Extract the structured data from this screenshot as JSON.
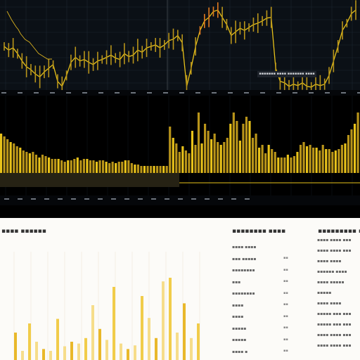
{
  "chart_data": [
    {
      "type": "line",
      "title": "",
      "x": [
        0,
        1,
        2,
        3,
        4,
        5,
        6,
        7,
        8,
        9,
        10,
        11,
        12,
        13,
        14,
        15,
        16,
        17,
        18,
        19,
        20,
        21,
        22,
        23,
        24,
        25,
        26,
        27,
        28,
        29,
        30,
        31,
        32,
        33,
        34,
        35,
        36,
        37,
        38,
        39,
        40,
        41,
        42,
        43,
        44,
        45,
        46,
        47,
        48,
        49,
        50,
        51,
        52,
        53,
        54,
        55,
        56,
        57,
        58,
        59,
        60,
        61,
        62,
        63,
        64,
        65,
        66,
        67,
        68,
        69,
        70,
        71,
        72,
        73,
        74,
        75,
        76,
        77,
        78,
        79
      ],
      "series": [
        {
          "values": [
            60,
            55,
            58,
            50,
            40,
            32,
            28,
            22,
            18,
            25,
            30,
            35,
            12,
            5,
            20,
            38,
            45,
            40,
            42,
            38,
            35,
            40,
            42,
            45,
            48,
            44,
            42,
            50,
            46,
            48,
            55,
            52,
            58,
            60,
            62,
            58,
            62,
            68,
            70,
            75,
            65,
            5,
            30,
            60,
            82,
            95,
            100,
            108,
            110,
            100,
            90,
            75,
            80,
            85,
            82,
            86,
            90,
            92,
            95,
            99,
            100,
            30,
            12,
            10,
            5,
            8,
            6,
            10,
            5,
            4,
            8,
            6,
            8,
            20,
            40,
            60,
            82,
            92,
            105,
            110
          ]
        },
        {
          "values": [
            112,
            106,
            100,
            95,
            90,
            86,
            80,
            76,
            72,
            70,
            68,
            64,
            60,
            56,
            52,
            50,
            48,
            46,
            44,
            44,
            44
          ]
        }
      ],
      "grid": true
    },
    {
      "type": "bar",
      "title": "",
      "values": [
        56,
        52,
        48,
        44,
        42,
        38,
        36,
        32,
        30,
        28,
        30,
        26,
        22,
        26,
        24,
        22,
        20,
        20,
        20,
        18,
        16,
        18,
        18,
        20,
        22,
        18,
        20,
        20,
        18,
        18,
        16,
        18,
        18,
        16,
        14,
        16,
        14,
        16,
        16,
        18,
        18,
        14,
        12,
        12,
        10,
        10,
        10,
        10,
        10,
        10,
        10,
        10,
        10,
        66,
        50,
        42,
        30,
        38,
        32,
        28,
        60,
        40,
        86,
        42,
        70,
        60,
        48,
        56,
        44,
        40,
        44,
        50,
        70,
        86,
        74,
        46,
        70,
        80,
        74,
        50,
        56,
        36,
        40,
        28,
        40,
        34,
        30,
        22,
        22,
        22,
        26,
        22,
        24,
        30,
        40,
        44,
        38,
        40,
        36,
        36,
        32,
        40,
        34,
        34,
        30,
        32,
        34,
        40,
        42,
        54,
        62,
        70,
        86
      ],
      "grid": true
    },
    {
      "type": "bar",
      "title": "",
      "values": [
        30,
        10,
        40,
        20,
        12,
        10,
        45,
        15,
        20,
        18,
        24,
        60,
        34,
        22,
        80,
        18,
        12,
        16,
        70,
        46,
        24,
        86,
        90,
        30,
        62,
        24,
        40
      ],
      "grid": true
    }
  ],
  "price_badge": "▪▪▪▪▪▪▪ ▪▪▪▪ ▪▪▪▪▪▪▪ ▪▪▪▪",
  "report": {
    "left_heading": "▪▪▪▪ ▪▪▪▪▪▪",
    "mid_heading": "▪▪▪▪▪▪▪▪ ▪▪▪▪",
    "right_heading": "▪▪▪▪▪▪▪▪▪ ▪▪▪▪▪",
    "mid_rows": [
      "▪▪▪▪ ▪▪▪▪",
      "▪▪▪ ▪▪▪▪▪",
      "▪▪▪▪▪▪▪▪",
      "▪▪▪",
      "▪▪▪▪▪▪▪▪",
      "▪▪▪▪",
      "▪▪▪▪",
      "▪▪▪▪▪",
      "▪▪▪▪▪",
      "▪▪▪▪ ▪"
    ],
    "mid_values": [
      "▪▪",
      "▪▪",
      "▪▪",
      "▪▪",
      "▪▪",
      "▪▪",
      "▪▪",
      "▪▪",
      "▪▪"
    ],
    "right_rows": [
      "▪▪▪▪ ▪▪▪▪ ▪▪▪",
      "▪▪▪▪ ▪▪▪▪ ▪▪▪",
      "▪▪▪▪ ▪▪▪▪",
      "▪▪▪▪▪▪ ▪▪▪▪",
      "▪▪▪▪ ▪▪▪▪▪",
      "▪▪▪▪▪",
      "▪▪▪▪ ▪▪▪▪",
      "▪▪▪▪▪ ▪▪▪ ▪▪▪",
      "▪▪▪▪▪ ▪▪▪ ▪▪▪",
      "▪▪▪▪ ▪▪▪▪ ▪▪▪",
      "▪▪▪▪ ▪▪▪▪ ▪▪▪"
    ]
  },
  "colors": {
    "accent": "#e8c21a",
    "accent_dark": "#b8941a",
    "orange": "#e07a1f",
    "price_bg": "#0b1016",
    "grid": "#1c2530",
    "report_bg": "#fcfbf8",
    "report_bar": "#f1cc4a"
  }
}
